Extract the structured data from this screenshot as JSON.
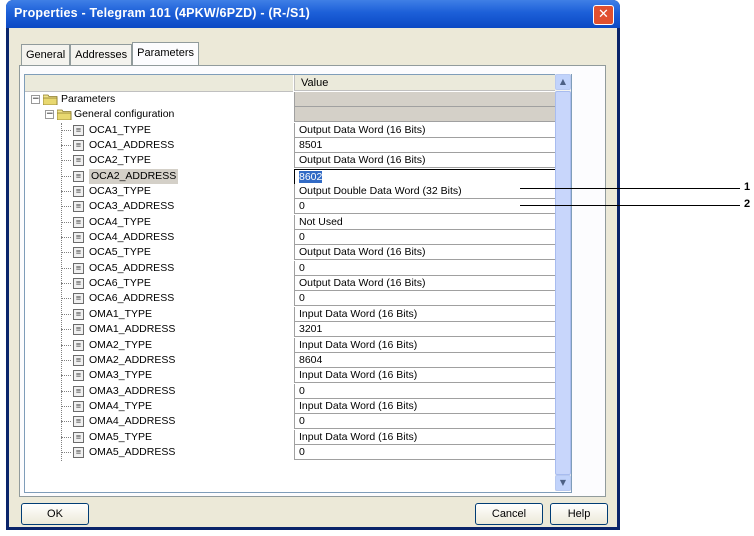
{
  "window": {
    "title": "Properties - Telegram 101 (4PKW/6PZD) - (R-/S1)",
    "close_icon": "close-icon"
  },
  "tabs": [
    {
      "label": "General"
    },
    {
      "label": "Addresses"
    },
    {
      "label": "Parameters"
    }
  ],
  "grid": {
    "value_header": "Value",
    "tree": [
      {
        "label": "Parameters",
        "value": "",
        "kind": "root"
      },
      {
        "label": "General configuration",
        "value": "",
        "kind": "group"
      },
      {
        "label": "OCA1_TYPE",
        "value": "Output Data Word (16 Bits)"
      },
      {
        "label": "OCA1_ADDRESS",
        "value": "8501"
      },
      {
        "label": "OCA2_TYPE",
        "value": "Output Data Word (16 Bits)"
      },
      {
        "label": "OCA2_ADDRESS",
        "value": "8602",
        "selected": true
      },
      {
        "label": "OCA3_TYPE",
        "value": "Output Double Data Word (32 Bits)"
      },
      {
        "label": "OCA3_ADDRESS",
        "value": "0"
      },
      {
        "label": "OCA4_TYPE",
        "value": "Not Used"
      },
      {
        "label": "OCA4_ADDRESS",
        "value": "0"
      },
      {
        "label": "OCA5_TYPE",
        "value": "Output Data Word (16 Bits)"
      },
      {
        "label": "OCA5_ADDRESS",
        "value": "0"
      },
      {
        "label": "OCA6_TYPE",
        "value": "Output Data Word (16 Bits)"
      },
      {
        "label": "OCA6_ADDRESS",
        "value": "0"
      },
      {
        "label": "OMA1_TYPE",
        "value": "Input Data Word (16 Bits)"
      },
      {
        "label": "OMA1_ADDRESS",
        "value": "3201"
      },
      {
        "label": "OMA2_TYPE",
        "value": "Input Data Word (16 Bits)"
      },
      {
        "label": "OMA2_ADDRESS",
        "value": "8604"
      },
      {
        "label": "OMA3_TYPE",
        "value": "Input Data Word (16 Bits)"
      },
      {
        "label": "OMA3_ADDRESS",
        "value": "0"
      },
      {
        "label": "OMA4_TYPE",
        "value": "Input Data Word (16 Bits)"
      },
      {
        "label": "OMA4_ADDRESS",
        "value": "0"
      },
      {
        "label": "OMA5_TYPE",
        "value": "Input Data Word (16 Bits)"
      },
      {
        "label": "OMA5_ADDRESS",
        "value": "0"
      }
    ]
  },
  "buttons": {
    "ok": "OK",
    "cancel": "Cancel",
    "help": "Help"
  },
  "callouts": [
    {
      "label": "1"
    },
    {
      "label": "2"
    }
  ],
  "colors": {
    "titlebar": "#0b49c4",
    "selection": "#316ac5",
    "dialog_bg": "#ece9d8"
  }
}
